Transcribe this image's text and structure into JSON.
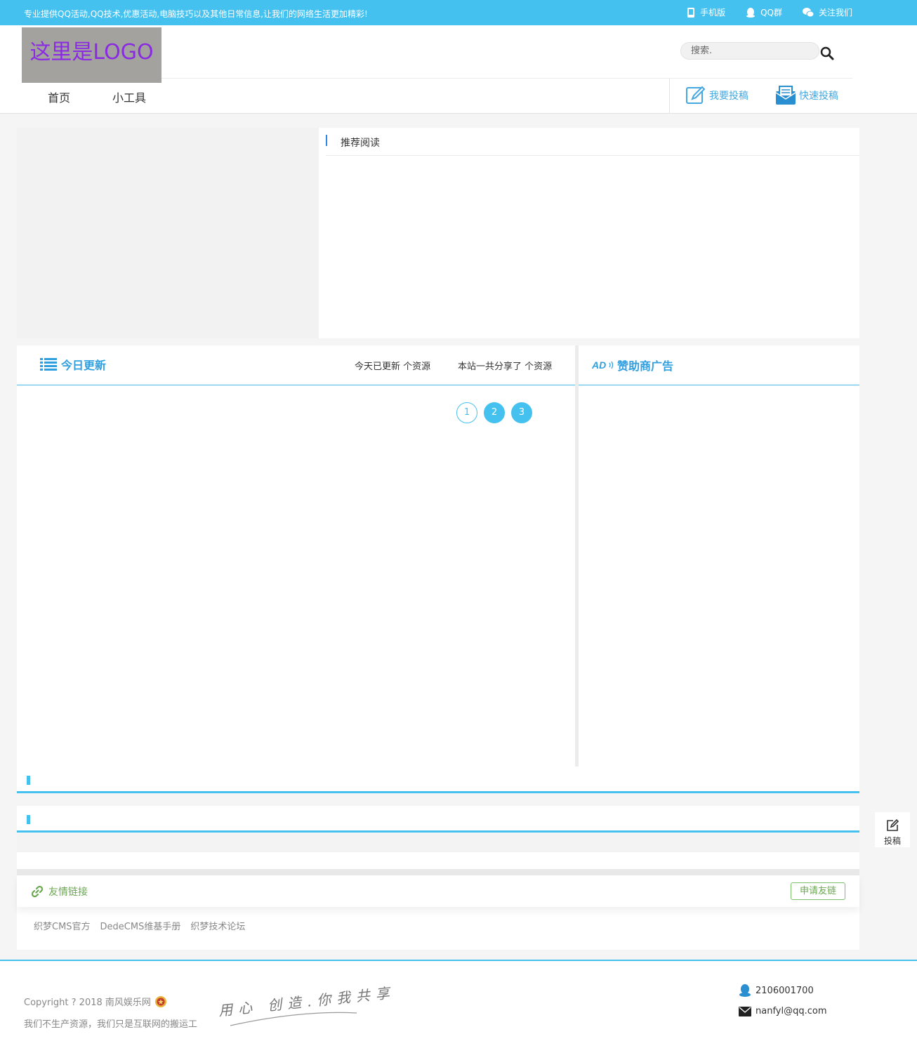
{
  "topbar": {
    "slogan": "专业提供QQ活动,QQ技术,优惠活动,电脑技巧以及其他日常信息,让我们的网络生活更加精彩!",
    "links": [
      "手机版",
      "QQ群",
      "关注我们"
    ]
  },
  "header": {
    "logo_text": "这里是LOGO",
    "search_placeholder": "搜索.",
    "nav": [
      "首页",
      "小工具"
    ],
    "submit_label": "我要投稿",
    "quick_submit_label": "快速投稿"
  },
  "recommend": {
    "title": "推荐阅读"
  },
  "today": {
    "title": "今日更新",
    "stat_today": "今天已更新 个资源",
    "stat_total": "本站一共分享了 个资源",
    "pages": [
      "1",
      "2",
      "3"
    ]
  },
  "ad": {
    "badge": "AD",
    "title": "赞助商广告"
  },
  "friend": {
    "title": "友情链接",
    "apply_label": "申请友链",
    "links": [
      "织梦CMS官方",
      "DedeCMS维基手册",
      "织梦技术论坛"
    ]
  },
  "side": {
    "submit_label": "投稿"
  },
  "footer": {
    "copyright": "Copyright ? 2018 南风娱乐网",
    "tagline": "我们不生产资源，我们只是互联网的搬运工",
    "signature": "用心 创造.你我共享",
    "qq": "2106001700",
    "email": "nanfyl@qq.com"
  },
  "colors": {
    "accent": "#45c1f0",
    "link_blue": "#2f9fe0",
    "friend_green": "#6aa84f"
  }
}
